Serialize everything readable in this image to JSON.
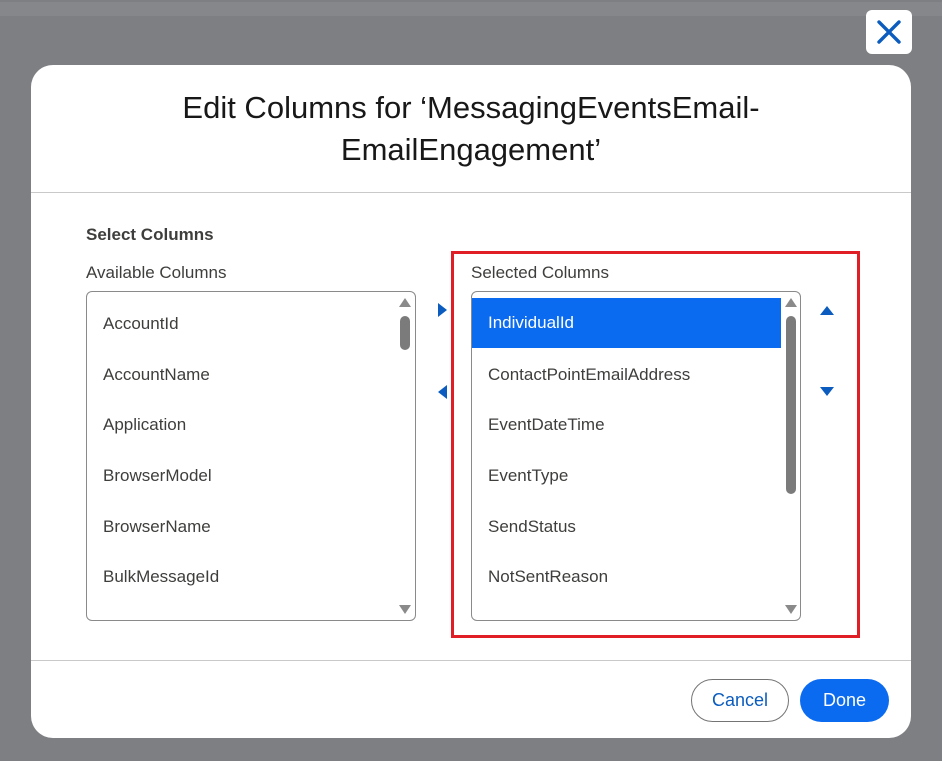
{
  "dialog": {
    "title": "Edit Columns for ‘MessagingEventsEmail-EmailEngagement’",
    "close_icon": "close-icon"
  },
  "select_columns": {
    "section_label": "Select Columns",
    "available": {
      "label": "Available Columns",
      "items": [
        "AccountId",
        "AccountName",
        "Application",
        "BrowserModel",
        "BrowserName",
        "BulkMessageId"
      ]
    },
    "selected": {
      "label": "Selected Columns",
      "items": [
        "IndividualId",
        "ContactPointEmailAddress",
        "EventDateTime",
        "EventType",
        "SendStatus",
        "NotSentReason"
      ],
      "selected_item": "IndividualId"
    },
    "move_controls": {
      "add_icon": "arrow-right-icon",
      "remove_icon": "arrow-left-icon",
      "move_up_icon": "arrow-up-icon",
      "move_down_icon": "arrow-down-icon"
    }
  },
  "footer": {
    "cancel_label": "Cancel",
    "done_label": "Done"
  },
  "colors": {
    "brand": "#0b6bf0",
    "link": "#0b5cbe",
    "highlight": "#e01e26"
  }
}
